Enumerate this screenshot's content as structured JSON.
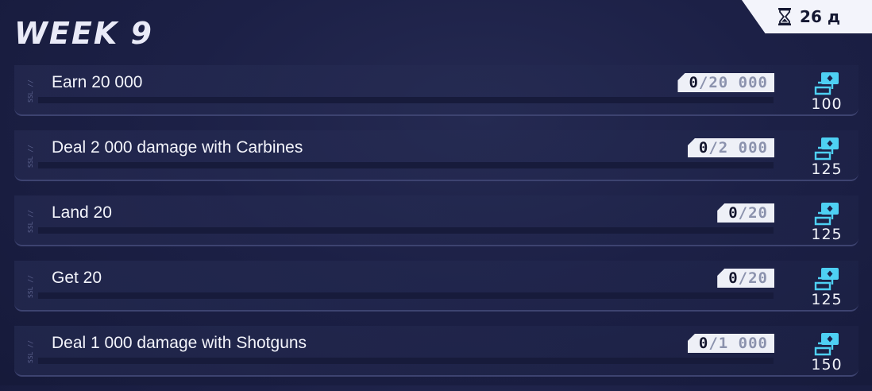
{
  "header": {
    "title": "WEEK 9",
    "timer_icon": "hourglass-icon",
    "timer_text": "26 д"
  },
  "colors": {
    "background": "#1c2046",
    "text": "#f3f4fb",
    "counter_bg": "#eef0f7",
    "reward_accent": "#4ed0f3"
  },
  "quests": [
    {
      "side_tag": "SSL //",
      "label": "Earn 20 000",
      "current": "0",
      "goal": "20 000",
      "progress": 0,
      "reward_icon": "cards-icon",
      "reward": "100"
    },
    {
      "side_tag": "SSL //",
      "label": "Deal 2 000 damage with Carbines",
      "current": "0",
      "goal": "2 000",
      "progress": 0,
      "reward_icon": "cards-icon",
      "reward": "125"
    },
    {
      "side_tag": "SSL //",
      "label": "Land 20",
      "current": "0",
      "goal": "20",
      "progress": 0,
      "reward_icon": "cards-icon",
      "reward": "125"
    },
    {
      "side_tag": "SSL //",
      "label": "Get 20",
      "current": "0",
      "goal": "20",
      "progress": 0,
      "reward_icon": "cards-icon",
      "reward": "125"
    },
    {
      "side_tag": "SSL //",
      "label": "Deal 1 000 damage with Shotguns",
      "current": "0",
      "goal": "1 000",
      "progress": 0,
      "reward_icon": "cards-icon",
      "reward": "150"
    }
  ]
}
